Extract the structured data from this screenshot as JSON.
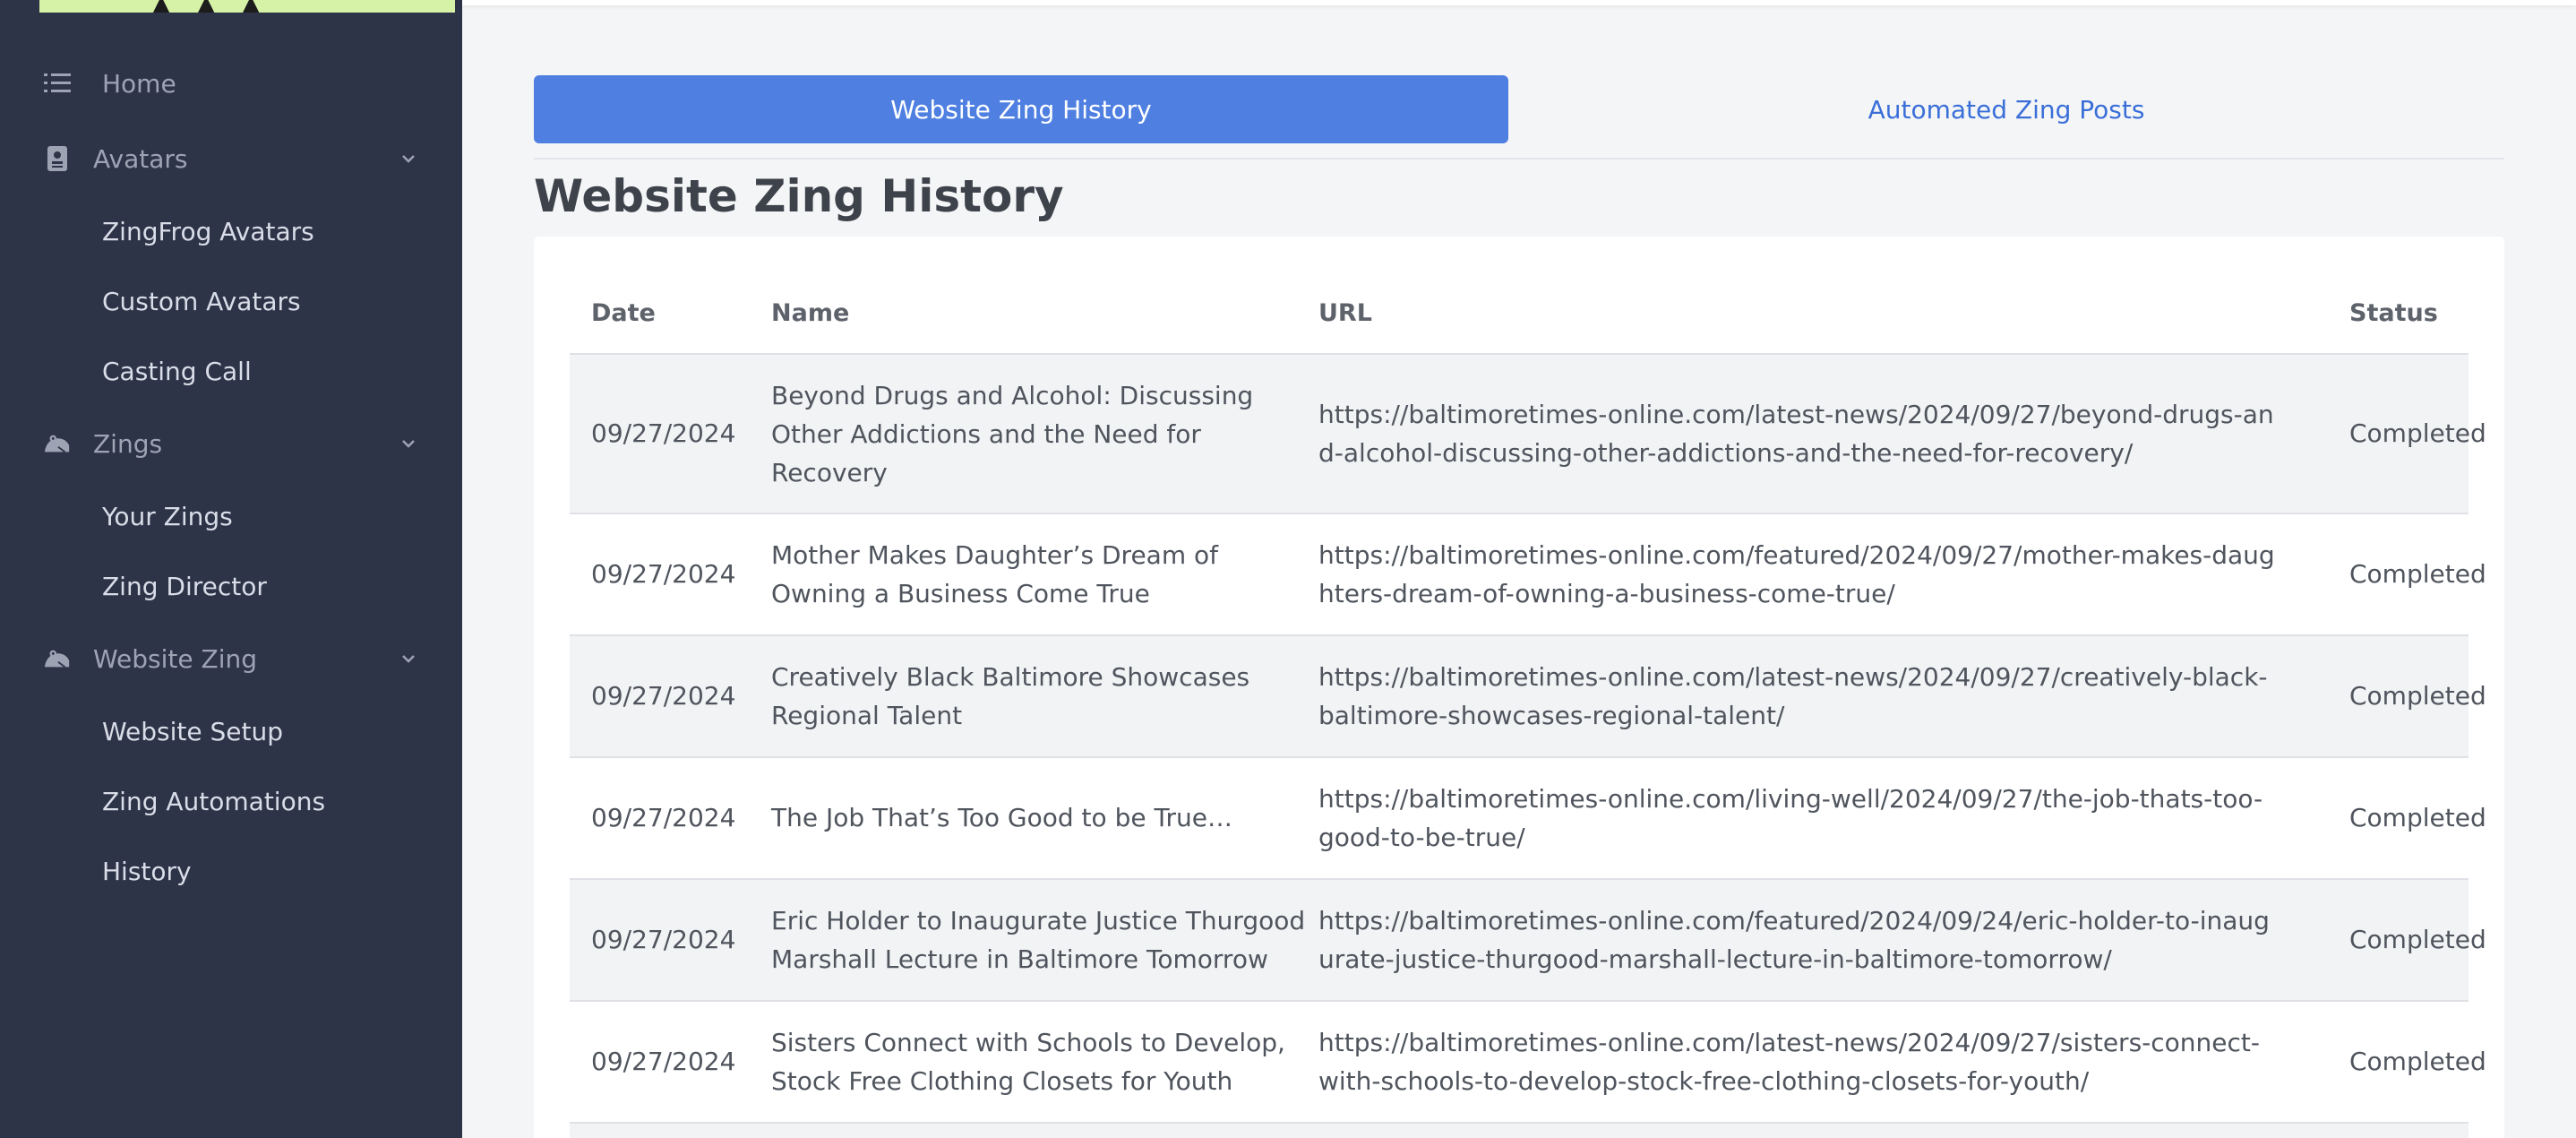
{
  "sidebar": {
    "home": "Home",
    "avatars": "Avatars",
    "avatars_items": [
      "ZingFrog Avatars",
      "Custom Avatars",
      "Casting Call"
    ],
    "zings": "Zings",
    "zings_items": [
      "Your Zings",
      "Zing Director"
    ],
    "website_zing": "Website Zing",
    "website_zing_items": [
      "Website Setup",
      "Zing Automations",
      "History"
    ],
    "icons": {
      "home": "list-icon",
      "avatars": "id-badge-icon",
      "zings": "frog-icon",
      "website_zing": "frog-icon",
      "expand": "chevron-down-icon"
    }
  },
  "tabs": {
    "active": "Website Zing History",
    "inactive": "Automated Zing Posts"
  },
  "page": {
    "title": "Website Zing History"
  },
  "table": {
    "headers": {
      "date": "Date",
      "name": "Name",
      "url": "URL",
      "status": "Status"
    },
    "rows": [
      {
        "date": "09/27/2024",
        "name": "Beyond Drugs and Alcohol: Discussing Other Addictions and the Need for Recovery",
        "url": "https://baltimoretimes-online.com/latest-news/2024/09/27/beyond-drugs-and-alcohol-discussing-other-addictions-and-the-need-for-recovery/",
        "status": "Completed"
      },
      {
        "date": "09/27/2024",
        "name": "Mother Makes Daughter’s Dream of Owning a Business Come True",
        "url": "https://baltimoretimes-online.com/featured/2024/09/27/mother-makes-daughters-dream-of-owning-a-business-come-true/",
        "status": "Completed"
      },
      {
        "date": "09/27/2024",
        "name": "Creatively Black Baltimore Showcases Regional Talent",
        "url": "https://baltimoretimes-online.com/latest-news/2024/09/27/creatively-black-baltimore-showcases-regional-talent/",
        "status": "Completed"
      },
      {
        "date": "09/27/2024",
        "name": "The Job That’s Too Good to be True…",
        "url": "https://baltimoretimes-online.com/living-well/2024/09/27/the-job-thats-too-good-to-be-true/",
        "status": "Completed"
      },
      {
        "date": "09/27/2024",
        "name": "Eric Holder to Inaugurate Justice Thurgood Marshall Lecture in Baltimore Tomorrow",
        "url": "https://baltimoretimes-online.com/featured/2024/09/24/eric-holder-to-inaugurate-justice-thurgood-marshall-lecture-in-baltimore-tomorrow/",
        "status": "Completed"
      },
      {
        "date": "09/27/2024",
        "name": "Sisters Connect with Schools to Develop, Stock Free Clothing Closets for Youth",
        "url": "https://baltimoretimes-online.com/latest-news/2024/09/27/sisters-connect-with-schools-to-develop-stock-free-clothing-closets-for-youth/",
        "status": "Completed"
      }
    ]
  },
  "colors": {
    "sidebar_bg": "#2e3448",
    "accent": "#4f80e1",
    "link": "#3a6fd8",
    "logo_bg": "#d6f2a6"
  }
}
